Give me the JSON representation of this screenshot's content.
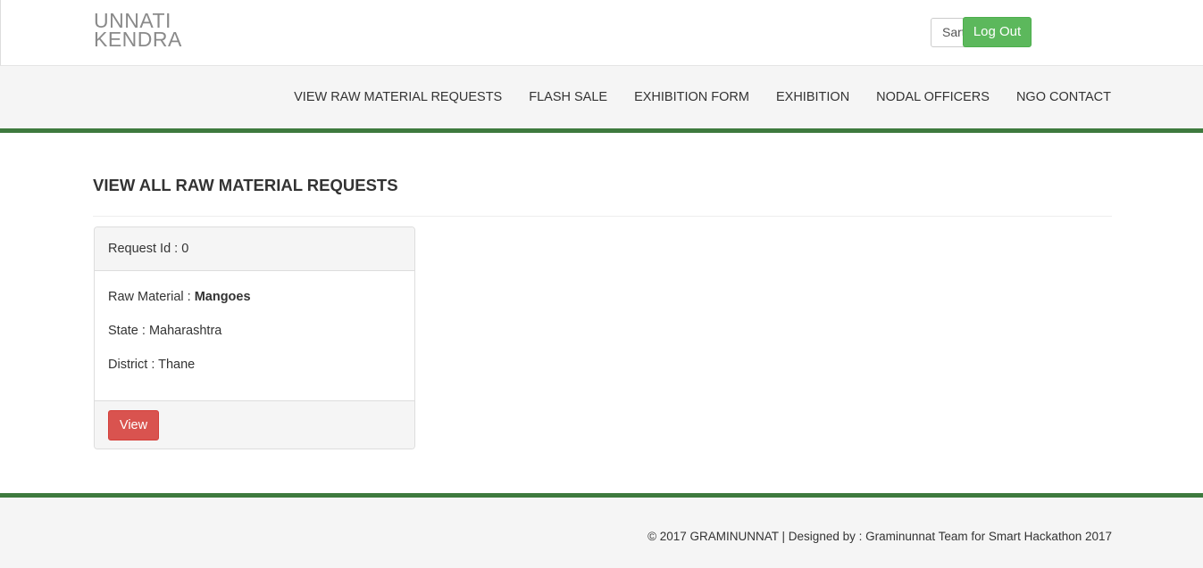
{
  "header": {
    "logo_line1": "UNNATI",
    "logo_line2": "KENDRA",
    "user_name": "Sarthak",
    "logout_label": "Log Out"
  },
  "nav": {
    "items": [
      {
        "label": "VIEW RAW MATERIAL REQUESTS"
      },
      {
        "label": "FLASH SALE"
      },
      {
        "label": "EXHIBITION FORM"
      },
      {
        "label": "EXHIBITION"
      },
      {
        "label": "NODAL OFFICERS"
      },
      {
        "label": "NGO CONTACT"
      }
    ]
  },
  "main": {
    "title": "VIEW ALL RAW MATERIAL REQUESTS",
    "requests": [
      {
        "id_text": "Request Id : 0",
        "raw_material_label": "Raw Material : ",
        "raw_material_value": "Mangoes",
        "state_text": "State : Maharashtra",
        "district_text": "District : Thane",
        "view_label": "View"
      }
    ]
  },
  "footer": {
    "text": "© 2017 GRAMINUNNAT | Designed by : Graminunnat Team for Smart Hackathon 2017"
  },
  "colors": {
    "accent_green": "#3e7a3e",
    "logout_green": "#5cb85c",
    "view_red": "#d9534f"
  }
}
